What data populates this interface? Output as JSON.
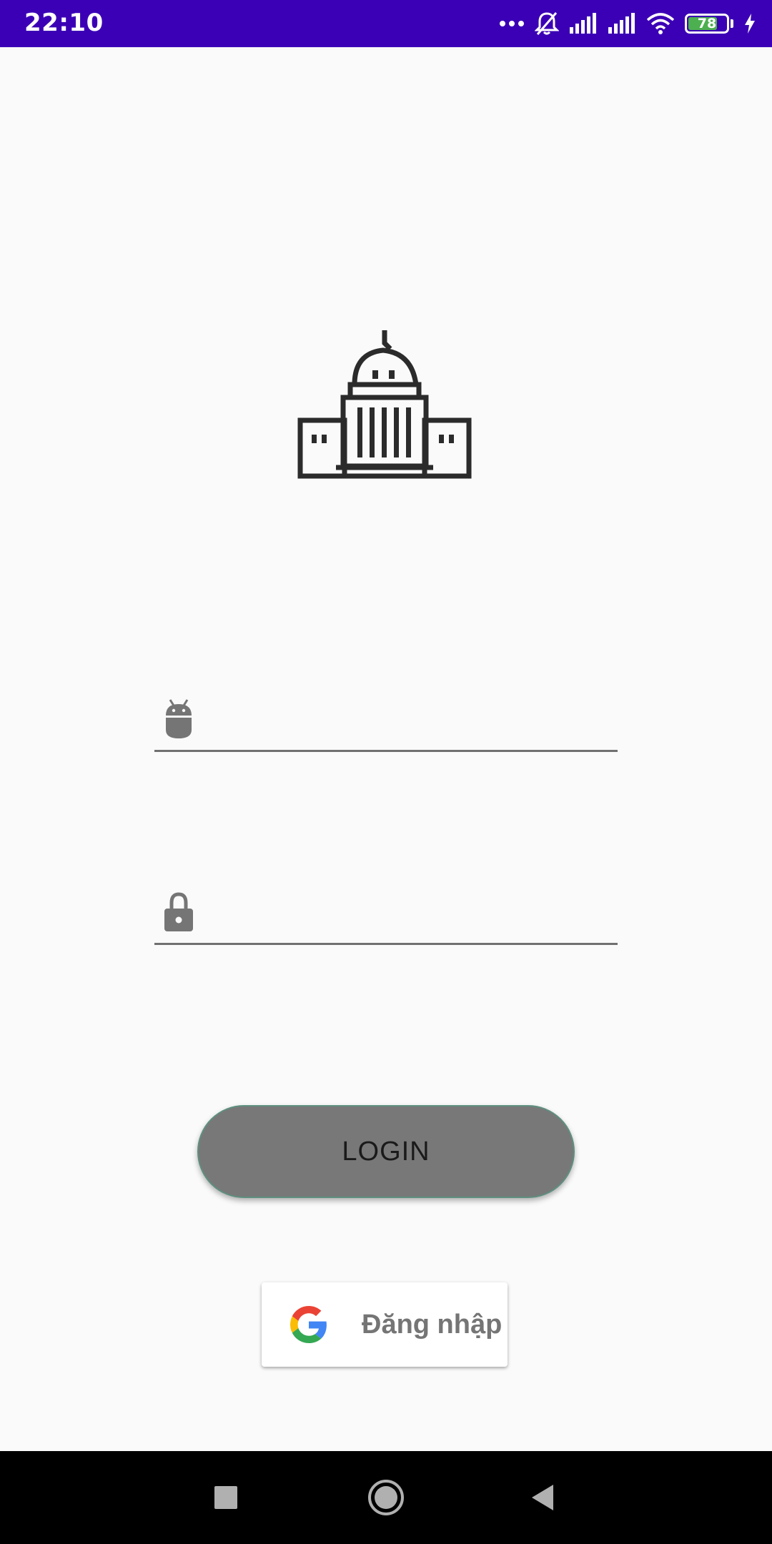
{
  "status_bar": {
    "time": "22:10",
    "battery_level": "78",
    "battery_fraction": 0.78,
    "color": "#3b00b5"
  },
  "logo": {
    "icon": "capitol-building-icon"
  },
  "username_field": {
    "icon": "android-icon",
    "value": "",
    "placeholder": ""
  },
  "password_field": {
    "icon": "lock-icon",
    "value": "",
    "placeholder": ""
  },
  "login_button": {
    "label": "LOGIN",
    "color": "#787878"
  },
  "google_button": {
    "label": "Đăng nhập",
    "icon": "google-icon"
  },
  "nav_bar": {
    "recent": "recent-apps-icon",
    "home": "home-icon",
    "back": "back-icon"
  }
}
